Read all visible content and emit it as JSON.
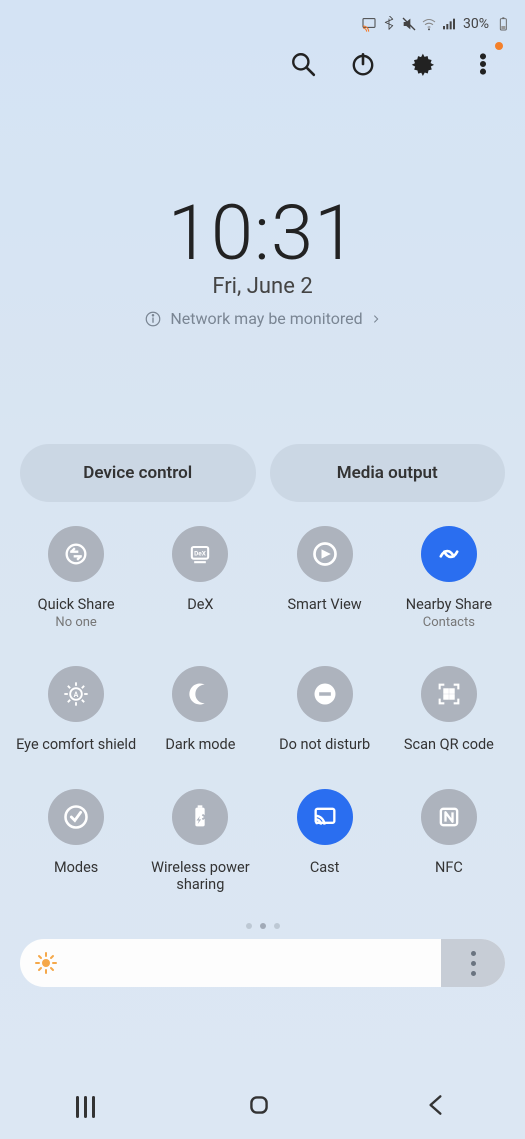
{
  "status": {
    "battery_pct": "30%",
    "indicators": [
      "cast",
      "bluetooth",
      "mute",
      "wifi",
      "signal",
      "battery"
    ]
  },
  "actions": {
    "search": "Search",
    "power": "Power",
    "settings": "Settings",
    "more": "More"
  },
  "clock": {
    "time": "10:31",
    "date": "Fri, June 2",
    "network_msg": "Network may be monitored"
  },
  "pills": {
    "device_control": "Device control",
    "media_output": "Media output"
  },
  "tiles": [
    {
      "id": "quick-share",
      "label": "Quick Share",
      "sub": "No one",
      "active": false,
      "icon": "swap"
    },
    {
      "id": "dex",
      "label": "DeX",
      "sub": "",
      "active": false,
      "icon": "dex"
    },
    {
      "id": "smart-view",
      "label": "Smart View",
      "sub": "",
      "active": false,
      "icon": "smartview"
    },
    {
      "id": "nearby-share",
      "label": "Nearby Share",
      "sub": "Contacts",
      "active": true,
      "icon": "nearby"
    },
    {
      "id": "eye-comfort",
      "label": "Eye comfort shield",
      "sub": "",
      "active": false,
      "icon": "eye"
    },
    {
      "id": "dark-mode",
      "label": "Dark mode",
      "sub": "",
      "active": false,
      "icon": "moon"
    },
    {
      "id": "dnd",
      "label": "Do not disturb",
      "sub": "",
      "active": false,
      "icon": "dnd"
    },
    {
      "id": "scan-qr",
      "label": "Scan QR code",
      "sub": "",
      "active": false,
      "icon": "qr"
    },
    {
      "id": "modes",
      "label": "Modes",
      "sub": "",
      "active": false,
      "icon": "modes"
    },
    {
      "id": "wireless-power",
      "label": "Wireless power sharing",
      "sub": "",
      "active": false,
      "icon": "battery-share"
    },
    {
      "id": "cast",
      "label": "Cast",
      "sub": "",
      "active": true,
      "icon": "cast"
    },
    {
      "id": "nfc",
      "label": "NFC",
      "sub": "",
      "active": false,
      "icon": "nfc"
    }
  ],
  "pager": {
    "count": 3,
    "active_index": 1
  },
  "nav": {
    "recents": "Recents",
    "home": "Home",
    "back": "Back"
  }
}
